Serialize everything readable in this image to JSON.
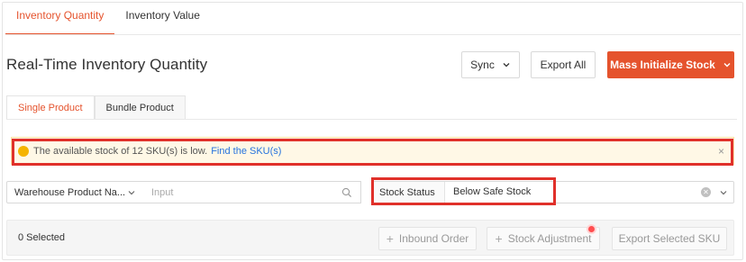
{
  "top_tabs": [
    {
      "label": "Inventory Quantity",
      "active": true
    },
    {
      "label": "Inventory Value",
      "active": false
    }
  ],
  "header": {
    "title": "Real-Time Inventory Quantity",
    "sync_label": "Sync",
    "export_all_label": "Export All",
    "mass_init_label": "Mass Initialize Stock"
  },
  "sub_tabs": [
    {
      "label": "Single Product",
      "active": true
    },
    {
      "label": "Bundle Product",
      "active": false
    }
  ],
  "alert": {
    "text": "The available stock of 12 SKU(s) is low.",
    "link": "Find the SKU(s)",
    "close": "×"
  },
  "filter": {
    "search_field_select": "Warehouse Product Na...",
    "search_placeholder": "Input",
    "stock_status_label": "Stock Status",
    "stock_status_value": "Below Safe Stock"
  },
  "bottom": {
    "selected": "0 Selected",
    "inbound_label": "Inbound Order",
    "adjust_label": "Stock Adjustment",
    "export_selected_label": "Export Selected SKU"
  },
  "colors": {
    "accent": "#e5532d",
    "highlight_box": "#e0302a",
    "alert_bg": "#fff8e6",
    "link": "#2673dd"
  }
}
